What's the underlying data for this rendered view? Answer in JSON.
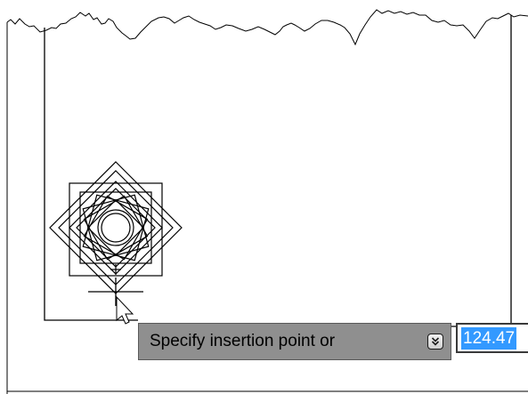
{
  "prompt": {
    "text": "Specify insertion point or",
    "options_icon": "down-arrow-icon"
  },
  "coordinate_input": {
    "value": "124.47"
  },
  "colors": {
    "tooltip_bg": "#8f8f8f",
    "selection": "#3399ff",
    "drawing_lines": "#000000",
    "background": "#ffffff"
  }
}
